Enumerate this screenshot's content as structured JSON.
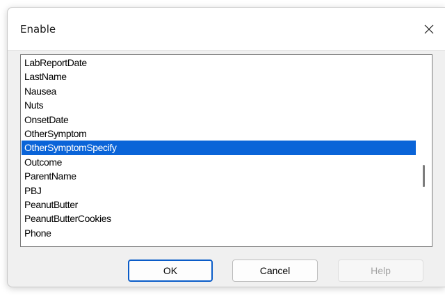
{
  "dialog": {
    "title": "Enable",
    "close_icon": "close-icon"
  },
  "listbox": {
    "items": [
      {
        "label": "LabReportDate",
        "selected": false
      },
      {
        "label": "LastName",
        "selected": false
      },
      {
        "label": "Nausea",
        "selected": false
      },
      {
        "label": "Nuts",
        "selected": false
      },
      {
        "label": "OnsetDate",
        "selected": false
      },
      {
        "label": "OtherSymptom",
        "selected": false
      },
      {
        "label": "OtherSymptomSpecify",
        "selected": true
      },
      {
        "label": "Outcome",
        "selected": false
      },
      {
        "label": "ParentName",
        "selected": false
      },
      {
        "label": "PBJ",
        "selected": false
      },
      {
        "label": "PeanutButter",
        "selected": false
      },
      {
        "label": "PeanutButterCookies",
        "selected": false
      },
      {
        "label": "Phone",
        "selected": false
      }
    ],
    "selection_color": "#0a64d8"
  },
  "buttons": {
    "ok_label": "OK",
    "cancel_label": "Cancel",
    "help_label": "Help",
    "help_enabled": false
  }
}
